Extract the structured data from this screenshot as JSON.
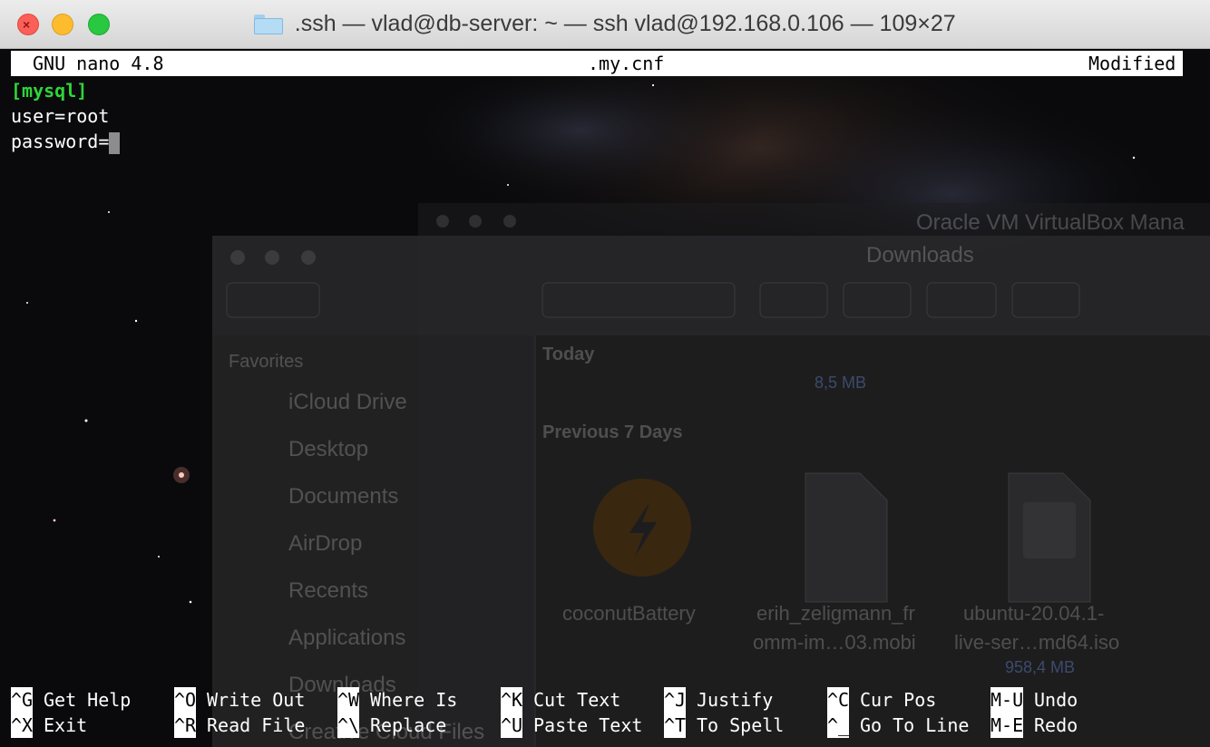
{
  "window": {
    "title": ".ssh — vlad@db-server: ~ — ssh vlad@192.168.0.106 — 109×27"
  },
  "nano": {
    "app": "GNU nano 4.8",
    "filename": ".my.cnf",
    "status": "Modified",
    "lines": [
      "[mysql]",
      "user=root",
      "password="
    ]
  },
  "shortcuts": [
    {
      "key": "^G",
      "label": "Get Help"
    },
    {
      "key": "^O",
      "label": "Write Out"
    },
    {
      "key": "^W",
      "label": "Where Is"
    },
    {
      "key": "^K",
      "label": "Cut Text"
    },
    {
      "key": "^J",
      "label": "Justify"
    },
    {
      "key": "^C",
      "label": "Cur Pos"
    },
    {
      "key": "M-U",
      "label": "Undo"
    },
    {
      "key": "^X",
      "label": "Exit"
    },
    {
      "key": "^R",
      "label": "Read File"
    },
    {
      "key": "^\\",
      "label": "Replace"
    },
    {
      "key": "^U",
      "label": "Paste Text"
    },
    {
      "key": "^T",
      "label": "To Spell"
    },
    {
      "key": "^_",
      "label": "Go To Line"
    },
    {
      "key": "M-E",
      "label": "Redo"
    }
  ],
  "background_ghost": {
    "virtualbox_title": "Oracle VM VirtualBox Mana",
    "finder_title": "Downloads",
    "sidebar_header": "Favorites",
    "sidebar_items": [
      "iCloud Drive",
      "Desktop",
      "Documents",
      "AirDrop",
      "Recents",
      "Applications",
      "Downloads",
      "Creative Cloud Files"
    ],
    "section_today": "Today",
    "today_size": "8,5 MB",
    "section_prev": "Previous 7 Days",
    "files": [
      {
        "name1": "coconutBattery",
        "name2": ""
      },
      {
        "name1": "erih_zeligmann_fr",
        "name2": "omm-im…03.mobi"
      },
      {
        "name1": "ubuntu-20.04.1-",
        "name2": "live-ser…md64.iso"
      }
    ],
    "iso_size": "958,4 MB"
  },
  "colors": {
    "keyword_green": "#2fd43a",
    "titlebar": "#e2e2e2",
    "terminal_bg": "#0a0a0c"
  }
}
